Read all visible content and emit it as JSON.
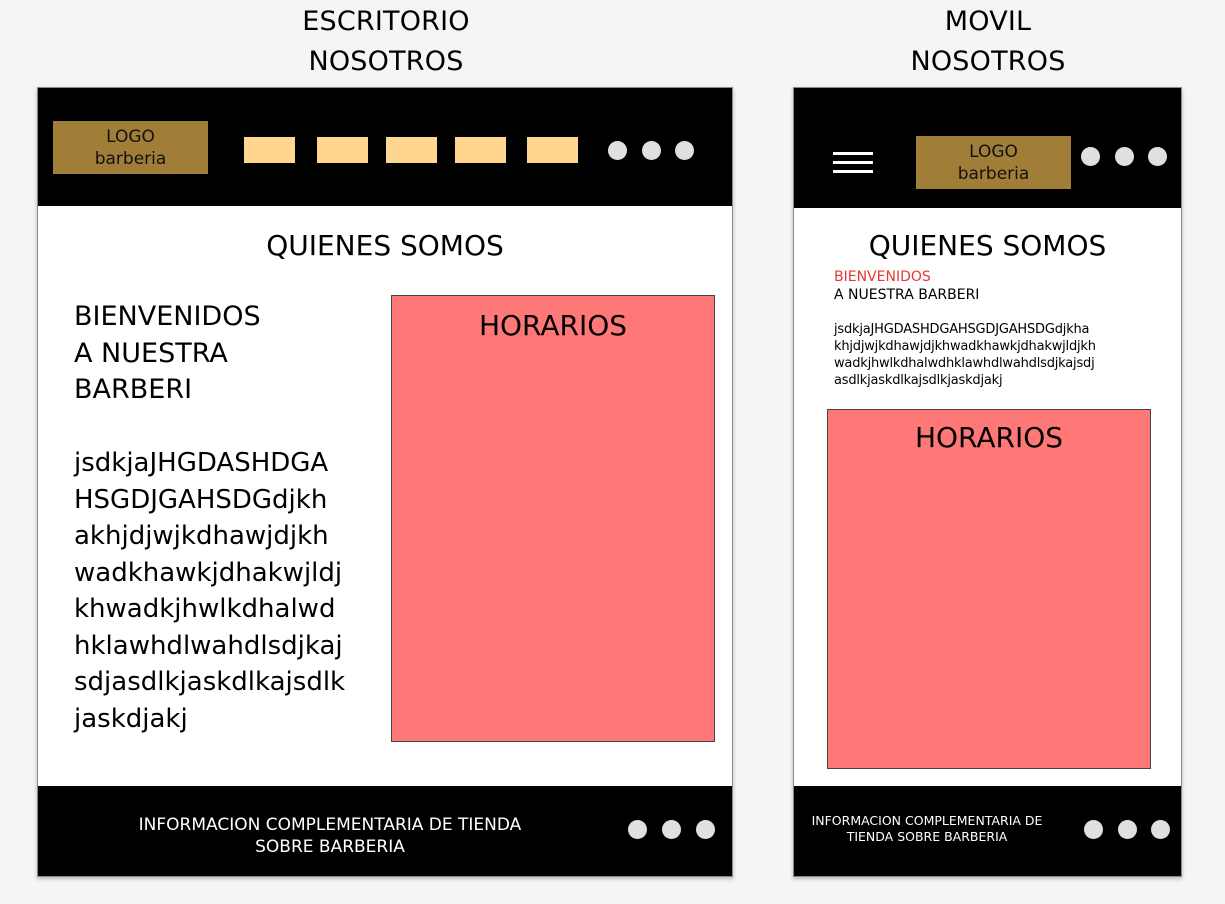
{
  "desktop": {
    "heading_line1": "ESCRITORIO",
    "heading_line2": "NOSOTROS",
    "logo_line1": "LOGO",
    "logo_line2": "barberia",
    "section_title": "QUIENES SOMOS",
    "welcome_lines": [
      "BIENVENIDOS",
      "A NUESTRA",
      "BARBERI"
    ],
    "body_lines": [
      "jsdkjaJHGDASHDGA",
      "HSGDJGAHSDGdjkh",
      "akhjdjwjkdhawjdjkh",
      "wadkhawkjdhakwjldj",
      "khwadkjhwlkdhalwd",
      "hklawhdlwahdlsdjkaj",
      "sdjasdlkjaskdlkajsdlk",
      "jaskdjakj"
    ],
    "horarios_title": "HORARIOS",
    "footer_line1": "INFORMACION COMPLEMENTARIA DE TIENDA",
    "footer_line2": "SOBRE BARBERIA"
  },
  "mobile": {
    "heading_line1": "MOVIL",
    "heading_line2": "NOSOTROS",
    "logo_line1": "LOGO",
    "logo_line2": "barberia",
    "section_title": "QUIENES SOMOS",
    "welcome_red": "BIENVENIDOS",
    "welcome_black": "A NUESTRA BARBERI",
    "body_lines": [
      "jsdkjaJHGDASHDGAHSGDJGAHSDGdjkha",
      "khjdjwjkdhawjdjkhwadkhawkjdhakwjldjkh",
      "wadkjhwlkdhalwdhklawhdlwahdlsdjkajsdj",
      "asdlkjaskdlkajsdlkjaskdjakj"
    ],
    "horarios_title": "HORARIOS",
    "footer_line1": "INFORMACION COMPLEMENTARIA DE",
    "footer_line2": "TIENDA SOBRE BARBERIA"
  },
  "colors": {
    "logo_bg": "#a07e37",
    "nav_button": "#ffd68f",
    "horarios_bg": "#ff7878",
    "welcome_red": "#e53935",
    "dot": "#e0e0e0"
  }
}
